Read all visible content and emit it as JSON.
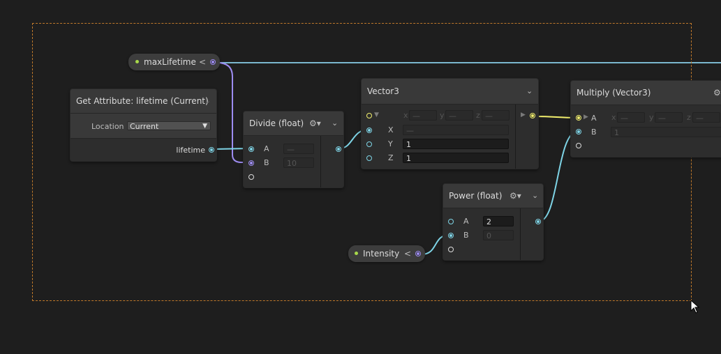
{
  "colors": {
    "canvas": "#1e1e1e",
    "selection_border": "#c0792a",
    "float_port": "#7ed4e6",
    "property_port": "#9d8cf0",
    "vector_port": "#f2ef6d",
    "exposed_dot": "#a8d94b"
  },
  "properties": {
    "max_lifetime": {
      "label": "maxLifetime",
      "chevron": "<"
    },
    "intensity": {
      "label": "Intensity",
      "chevron": "<"
    }
  },
  "get_attribute": {
    "title": "Get Attribute: lifetime (Current)",
    "location_label": "Location",
    "location_value": "Current",
    "output_label": "lifetime"
  },
  "divide": {
    "title": "Divide (float)",
    "a_label": "A",
    "a_value": "—",
    "b_label": "B",
    "b_value": "10"
  },
  "vector3": {
    "title": "Vector3",
    "x_label": "X",
    "x_value": "—",
    "y_label": "Y",
    "y_value": "1",
    "z_label": "Z",
    "z_value": "1",
    "compact": {
      "x": "x",
      "y": "y",
      "z": "z",
      "dash": "—"
    }
  },
  "power": {
    "title": "Power (float)",
    "a_label": "A",
    "a_value": "2",
    "b_label": "B",
    "b_value": "0"
  },
  "multiply": {
    "title": "Multiply (Vector3)",
    "a_label": "A",
    "b_label": "B",
    "b_value": "1",
    "compact": {
      "x": "x",
      "y": "y",
      "z": "z",
      "dash": "—"
    }
  }
}
